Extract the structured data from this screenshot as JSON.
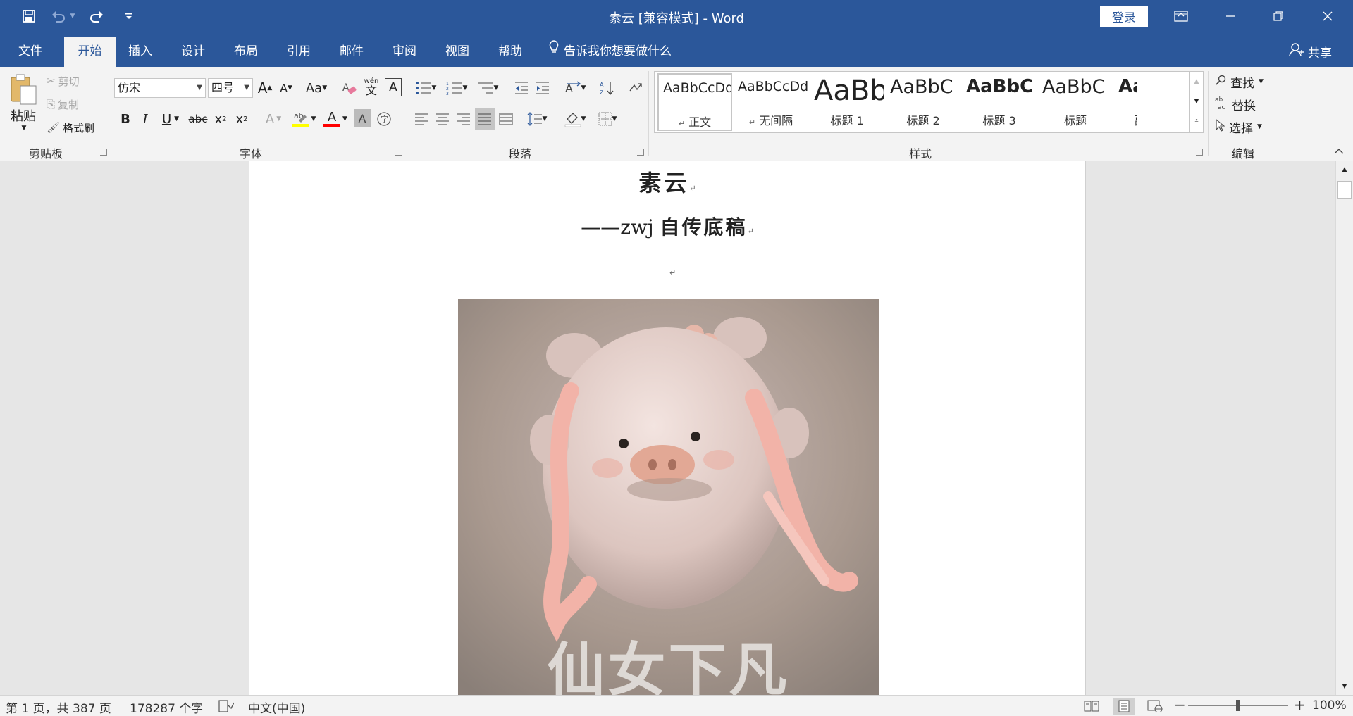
{
  "window": {
    "title": "素云 [兼容模式]  -  Word",
    "login_label": "登录"
  },
  "tabs": {
    "file": "文件",
    "home": "开始",
    "insert": "插入",
    "design": "设计",
    "layout": "布局",
    "references": "引用",
    "mailings": "邮件",
    "review": "审阅",
    "view": "视图",
    "help": "帮助",
    "tell_me": "告诉我你想要做什么",
    "share": "共享"
  },
  "clipboard": {
    "paste": "粘贴",
    "cut": "剪切",
    "copy": "复制",
    "format_painter": "格式刷",
    "group_label": "剪贴板"
  },
  "font": {
    "name": "仿宋",
    "size": "四号",
    "grow": "A",
    "shrink": "A",
    "change_case": "Aa",
    "phonetic_top": "wén",
    "phonetic_bottom": "文",
    "bold": "B",
    "italic": "I",
    "underline": "U",
    "strikethrough": "abc",
    "subscript": "x",
    "superscript": "x",
    "subscript_small": "2",
    "superscript_small": "2",
    "font_color": "A",
    "group_label": "字体"
  },
  "paragraph": {
    "group_label": "段落"
  },
  "styles": {
    "group_label": "样式",
    "items": [
      {
        "sample": "AaBbCcDd",
        "name": "正文"
      },
      {
        "sample": "AaBbCcDd",
        "name": "无间隔"
      },
      {
        "sample": "AaBb",
        "name": "标题 1"
      },
      {
        "sample": "AaBbC",
        "name": "标题 2"
      },
      {
        "sample": "AaBbC",
        "name": "标题 3"
      },
      {
        "sample": "AaBbC",
        "name": "标题"
      },
      {
        "sample": "AaBbC",
        "name": "副标题"
      }
    ]
  },
  "editing": {
    "find": "查找",
    "replace": "替换",
    "select": "选择",
    "group_label": "编辑"
  },
  "document": {
    "title": "素云",
    "subtitle_dash": "——zwj",
    "subtitle_text": "自传底稿",
    "para_mark": "↵",
    "image_caption": "仙女下凡"
  },
  "status": {
    "page": "第 1 页，共 387 页",
    "words": "178287 个字",
    "language": "中文(中国)",
    "zoom_minus": "−",
    "zoom_plus": "+",
    "zoom": "100%"
  },
  "zoom_level": 1.0,
  "colors": {
    "brand": "#2b579a",
    "highlight": "#ffff00",
    "font_color": "#ff0000"
  }
}
